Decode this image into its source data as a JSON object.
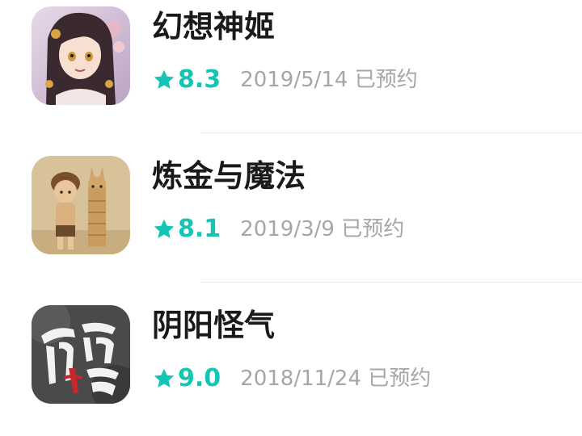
{
  "accent_color": "#14c5b5",
  "games": [
    {
      "title": "幻想神姬",
      "rating": "8.3",
      "date": "2019/5/14 已预约",
      "icon": "anime-girl-icon"
    },
    {
      "title": "炼金与魔法",
      "rating": "8.1",
      "date": "2019/3/9 已预约",
      "icon": "boy-and-alpaca-icon"
    },
    {
      "title": "阴阳怪气",
      "rating": "9.0",
      "date": "2018/11/24 已预约",
      "icon": "calligraphy-logo-icon"
    }
  ]
}
